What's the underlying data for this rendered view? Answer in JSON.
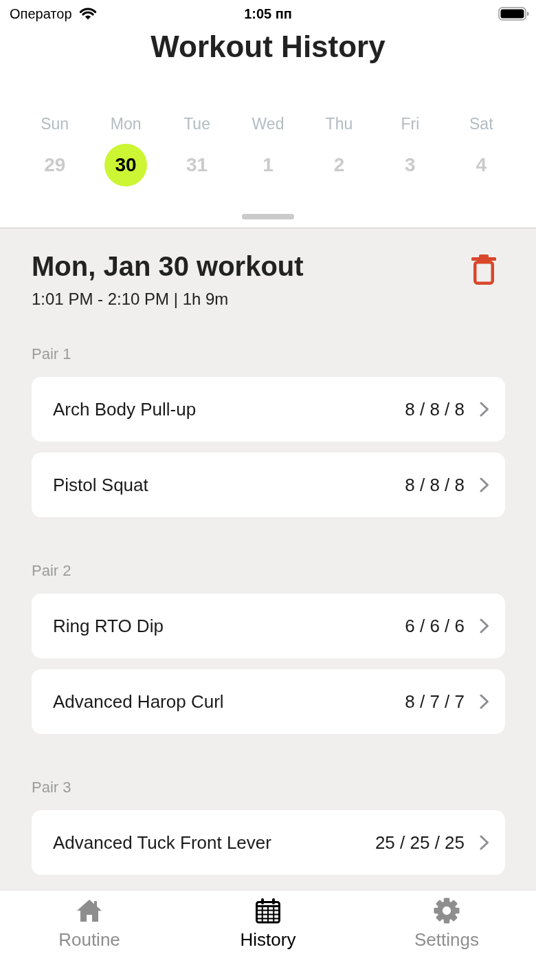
{
  "status_bar": {
    "carrier": "Оператор",
    "time": "1:05 пп"
  },
  "title": "Workout History",
  "week": [
    {
      "day": "Sun",
      "date": "29",
      "selected": false
    },
    {
      "day": "Mon",
      "date": "30",
      "selected": true
    },
    {
      "day": "Tue",
      "date": "31",
      "selected": false
    },
    {
      "day": "Wed",
      "date": "1",
      "selected": false
    },
    {
      "day": "Thu",
      "date": "2",
      "selected": false
    },
    {
      "day": "Fri",
      "date": "3",
      "selected": false
    },
    {
      "day": "Sat",
      "date": "4",
      "selected": false
    }
  ],
  "workout": {
    "title": "Mon, Jan 30 workout",
    "time_range": "1:01 PM - 2:10 PM | 1h 9m"
  },
  "pairs": [
    {
      "label": "Pair 1",
      "exercises": [
        {
          "name": "Arch Body Pull-up",
          "reps": "8 / 8 / 8"
        },
        {
          "name": "Pistol Squat",
          "reps": "8 / 8 / 8"
        }
      ]
    },
    {
      "label": "Pair 2",
      "exercises": [
        {
          "name": "Ring RTO Dip",
          "reps": "6 / 6 / 6"
        },
        {
          "name": "Advanced Harop Curl",
          "reps": "8 / 7 / 7"
        }
      ]
    },
    {
      "label": "Pair 3",
      "exercises": [
        {
          "name": "Advanced Tuck Front Lever",
          "reps": "25 / 25 / 25"
        }
      ]
    }
  ],
  "tab_bar": [
    {
      "label": "Routine",
      "selected": false
    },
    {
      "label": "History",
      "selected": true
    },
    {
      "label": "Settings",
      "selected": false
    }
  ]
}
